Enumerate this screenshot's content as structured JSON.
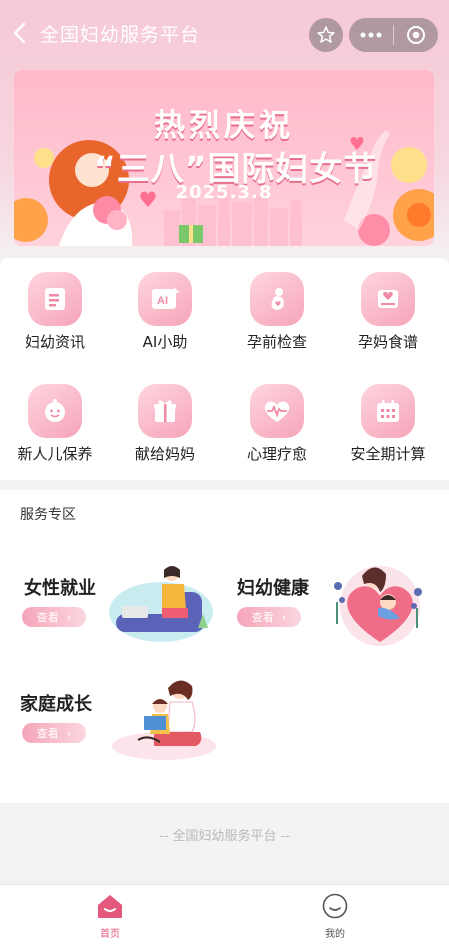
{
  "nav": {
    "title": "全国妇幼服务平台",
    "back_icon": "chevron-left-icon",
    "star_icon": "star-icon",
    "more_icon": "ellipsis-icon",
    "close_icon": "target-icon"
  },
  "banner": {
    "line1": "热烈庆祝",
    "line2": "“三八”国际妇女节",
    "date": "2025.3.8"
  },
  "grid": [
    {
      "label": "妇幼资讯",
      "icon": "news-icon"
    },
    {
      "label": "AI小助",
      "icon": "ai-icon"
    },
    {
      "label": "孕前检查",
      "icon": "pregnancy-check-icon"
    },
    {
      "label": "孕妈食谱",
      "icon": "recipe-icon"
    },
    {
      "label": "新人儿保养",
      "icon": "baby-icon"
    },
    {
      "label": "献给妈妈",
      "icon": "gift-icon"
    },
    {
      "label": "心理疗愈",
      "icon": "heartbeat-icon"
    },
    {
      "label": "安全期计算",
      "icon": "calendar-icon"
    }
  ],
  "services": {
    "title": "服务专区",
    "items": [
      {
        "name": "女性就业",
        "button": "查看"
      },
      {
        "name": "妇幼健康",
        "button": "查看"
      },
      {
        "name": "家庭成长",
        "button": "查看"
      }
    ]
  },
  "footer": {
    "text": "-- 全国妇幼服务平台 --"
  },
  "tabbar": {
    "home": "首页",
    "mine": "我的",
    "accent": "#e4587c",
    "inactive": "#555555"
  }
}
